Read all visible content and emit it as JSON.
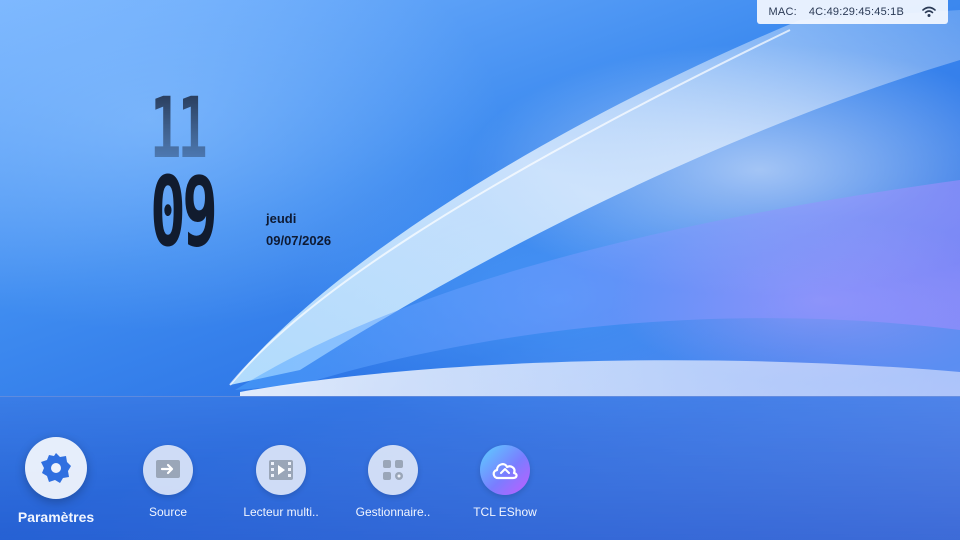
{
  "status_bar": {
    "mac_label": "MAC:",
    "mac_value": "4C:49:29:45:45:1B",
    "wifi_icon": "wifi-icon"
  },
  "clock": {
    "hours": "11",
    "minutes": "09",
    "day": "jeudi",
    "date": "09/07/2026"
  },
  "dock": {
    "apps": [
      {
        "label": "Paramètres",
        "icon": "gear-icon",
        "focused": true
      },
      {
        "label": "Source",
        "icon": "input-source-icon"
      },
      {
        "label": "Lecteur multi..",
        "icon": "media-player-icon"
      },
      {
        "label": "Gestionnaire..",
        "icon": "app-manager-icon"
      },
      {
        "label": "TCL EShow",
        "icon": "cloud-eshow-icon"
      }
    ]
  },
  "colors": {
    "accent_blue": "#2c74e6",
    "clock_text": "#111b2e",
    "focus_gear": "#2f6fe0"
  }
}
